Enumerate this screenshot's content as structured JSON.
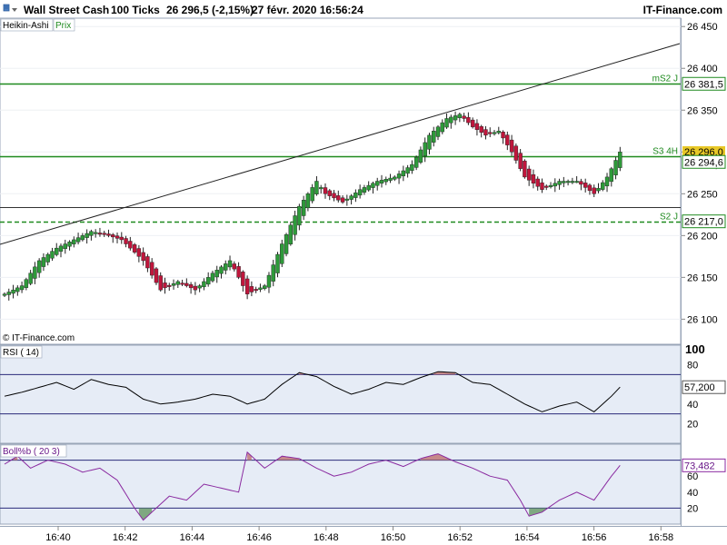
{
  "header": {
    "instrument": "Wall Street Cash",
    "interval": "100 Ticks",
    "quote": "26 296,5 (-2,15%)",
    "datetime": "27 févr. 2020 16:56:24",
    "brand": "IT-Finance.com"
  },
  "main_panel": {
    "style_label": "Heikin-Ashi",
    "price_tab": "Prix",
    "copyright": "© IT-Finance.com",
    "y_ticks": [
      "26 450",
      "26 400",
      "26 350",
      "26 300",
      "26 250",
      "26 200",
      "26 150",
      "26 100"
    ],
    "levels": {
      "ms2j": {
        "label": "mS2 J",
        "value": "26 381,5"
      },
      "s34h": {
        "label": "S3 4H",
        "value": "26 294,6"
      },
      "s2j": {
        "label": "S2 J",
        "value": "26 217,0"
      },
      "last": {
        "value": "26 296,0"
      },
      "hidden": {
        "value": "26 294,6"
      }
    }
  },
  "rsi_panel": {
    "label": "RSI ( 14)",
    "y_ticks": [
      "100",
      "80",
      "40",
      "20"
    ],
    "current": "57,200"
  },
  "boll_panel": {
    "label": "Boll%b ( 20 3)",
    "y_ticks": [
      "60",
      "40",
      "20"
    ],
    "current": "73,482"
  },
  "x_axis": {
    "ticks": [
      "16:40",
      "16:42",
      "16:44",
      "16:46",
      "16:48",
      "16:50",
      "16:52",
      "16:54",
      "16:56",
      "16:58"
    ]
  },
  "colors": {
    "up": "#2e9a3a",
    "down": "#c0163c",
    "level_line": "#1f8a1f",
    "trend_line": "#222222",
    "indicator_bg": "#e6ecf6",
    "rsi_line": "#000000",
    "boll_line": "#8a2aa0",
    "overbought_fill": "#c07878",
    "oversold_fill": "#6c9c6c"
  },
  "chart_data": [
    {
      "type": "candlestick",
      "title": "Wall Street Cash",
      "subtitle": "Heikin-Ashi",
      "ylim": [
        26070,
        26460
      ],
      "levels": [
        26381.5,
        26294.6,
        26217.0
      ],
      "close_anchors": [
        [
          0,
          26130
        ],
        [
          4,
          26140
        ],
        [
          8,
          26170
        ],
        [
          12,
          26185
        ],
        [
          16,
          26195
        ],
        [
          20,
          26205
        ],
        [
          24,
          26200
        ],
        [
          27,
          26195
        ],
        [
          32,
          26170
        ],
        [
          36,
          26135
        ],
        [
          40,
          26145
        ],
        [
          44,
          26135
        ],
        [
          48,
          26155
        ],
        [
          52,
          26170
        ],
        [
          56,
          26130
        ],
        [
          60,
          26140
        ],
        [
          64,
          26190
        ],
        [
          68,
          26235
        ],
        [
          72,
          26265
        ],
        [
          74,
          26250
        ],
        [
          78,
          26240
        ],
        [
          82,
          26255
        ],
        [
          86,
          26265
        ],
        [
          90,
          26270
        ],
        [
          94,
          26285
        ],
        [
          98,
          26320
        ],
        [
          102,
          26340
        ],
        [
          105,
          26345
        ],
        [
          108,
          26330
        ],
        [
          111,
          26320
        ],
        [
          114,
          26325
        ],
        [
          117,
          26300
        ],
        [
          120,
          26270
        ],
        [
          124,
          26255
        ],
        [
          128,
          26265
        ],
        [
          132,
          26265
        ],
        [
          136,
          26250
        ],
        [
          139,
          26270
        ],
        [
          142,
          26300
        ]
      ]
    },
    {
      "type": "line",
      "title": "RSI ( 14)",
      "ylim": [
        0,
        100
      ],
      "overbought": 70,
      "oversold": 30,
      "anchors": [
        [
          0,
          48
        ],
        [
          4,
          52
        ],
        [
          8,
          57
        ],
        [
          12,
          62
        ],
        [
          16,
          55
        ],
        [
          20,
          65
        ],
        [
          24,
          60
        ],
        [
          28,
          57
        ],
        [
          32,
          45
        ],
        [
          36,
          40
        ],
        [
          40,
          42
        ],
        [
          44,
          45
        ],
        [
          48,
          50
        ],
        [
          52,
          48
        ],
        [
          56,
          40
        ],
        [
          60,
          45
        ],
        [
          64,
          60
        ],
        [
          68,
          72
        ],
        [
          72,
          68
        ],
        [
          76,
          58
        ],
        [
          80,
          50
        ],
        [
          84,
          55
        ],
        [
          88,
          62
        ],
        [
          92,
          60
        ],
        [
          96,
          67
        ],
        [
          100,
          73
        ],
        [
          104,
          72
        ],
        [
          108,
          62
        ],
        [
          112,
          60
        ],
        [
          116,
          50
        ],
        [
          120,
          40
        ],
        [
          124,
          32
        ],
        [
          128,
          38
        ],
        [
          132,
          42
        ],
        [
          136,
          32
        ],
        [
          140,
          48
        ],
        [
          142,
          57.2
        ]
      ]
    },
    {
      "type": "line",
      "title": "Boll%b ( 20 3)",
      "ylim": [
        0,
        100
      ],
      "upper": 80,
      "lower": 20,
      "anchors": [
        [
          0,
          75
        ],
        [
          3,
          85
        ],
        [
          6,
          70
        ],
        [
          10,
          80
        ],
        [
          14,
          75
        ],
        [
          18,
          65
        ],
        [
          22,
          70
        ],
        [
          26,
          55
        ],
        [
          30,
          20
        ],
        [
          32,
          5
        ],
        [
          34,
          15
        ],
        [
          38,
          35
        ],
        [
          42,
          30
        ],
        [
          46,
          50
        ],
        [
          50,
          45
        ],
        [
          54,
          40
        ],
        [
          56,
          90
        ],
        [
          60,
          70
        ],
        [
          64,
          85
        ],
        [
          68,
          82
        ],
        [
          72,
          70
        ],
        [
          76,
          60
        ],
        [
          80,
          65
        ],
        [
          84,
          75
        ],
        [
          88,
          80
        ],
        [
          92,
          72
        ],
        [
          96,
          82
        ],
        [
          100,
          88
        ],
        [
          104,
          78
        ],
        [
          108,
          70
        ],
        [
          112,
          60
        ],
        [
          116,
          55
        ],
        [
          119,
          30
        ],
        [
          121,
          10
        ],
        [
          124,
          15
        ],
        [
          128,
          30
        ],
        [
          132,
          40
        ],
        [
          136,
          30
        ],
        [
          140,
          60
        ],
        [
          142,
          73.5
        ]
      ]
    }
  ]
}
